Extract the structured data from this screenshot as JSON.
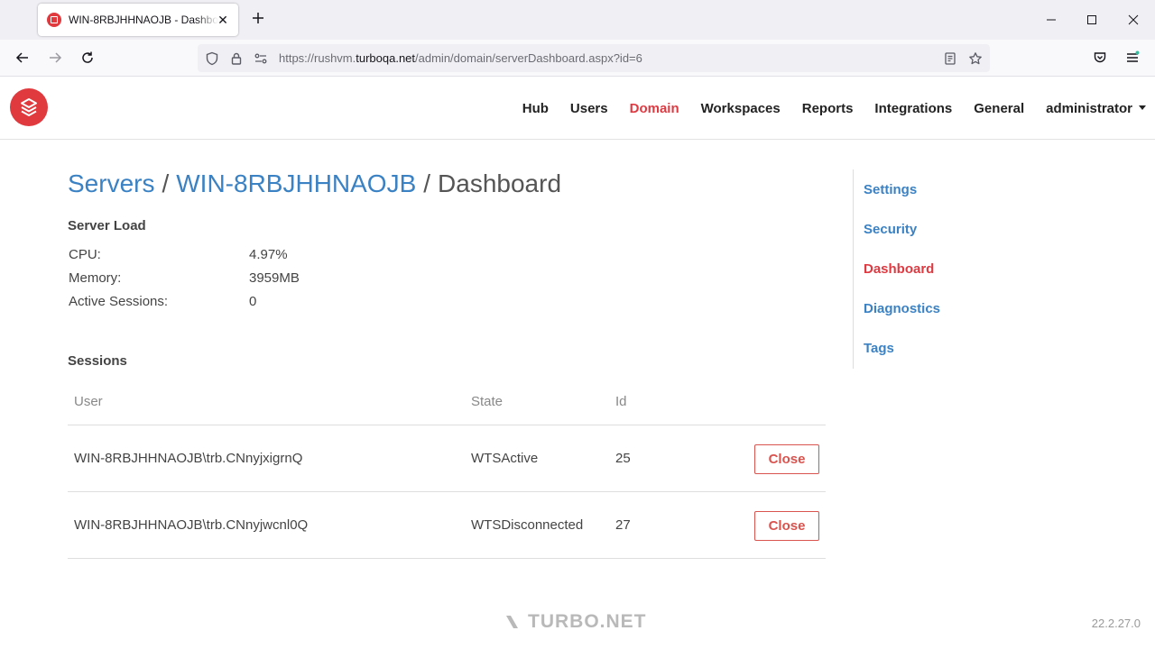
{
  "browser": {
    "tab_title": "WIN-8RBJHHNAOJB - Dashboard",
    "url_prefix": "https://rushvm.",
    "url_host": "turboqa.net",
    "url_path": "/admin/domain/serverDashboard.aspx?id=6"
  },
  "nav": {
    "items": [
      {
        "label": "Hub",
        "active": false
      },
      {
        "label": "Users",
        "active": false
      },
      {
        "label": "Domain",
        "active": true
      },
      {
        "label": "Workspaces",
        "active": false
      },
      {
        "label": "Reports",
        "active": false
      },
      {
        "label": "Integrations",
        "active": false
      },
      {
        "label": "General",
        "active": false
      }
    ],
    "user_label": "administrator"
  },
  "breadcrumb": {
    "servers": "Servers",
    "sep": "/",
    "server": "WIN-8RBJHHNAOJB",
    "current": "Dashboard"
  },
  "server_load": {
    "title": "Server Load",
    "rows": [
      {
        "label": "CPU:",
        "value": "4.97%"
      },
      {
        "label": "Memory:",
        "value": "3959MB"
      },
      {
        "label": "Active Sessions:",
        "value": "0"
      }
    ]
  },
  "sessions": {
    "title": "Sessions",
    "headers": {
      "user": "User",
      "state": "State",
      "id": "Id"
    },
    "rows": [
      {
        "user": "WIN-8RBJHHNAOJB\\trb.CNnyjxigrnQ",
        "state": "WTSActive",
        "id": "25",
        "action": "Close"
      },
      {
        "user": "WIN-8RBJHHNAOJB\\trb.CNnyjwcnl0Q",
        "state": "WTSDisconnected",
        "id": "27",
        "action": "Close"
      }
    ]
  },
  "sidenav": {
    "items": [
      {
        "label": "Settings",
        "active": false
      },
      {
        "label": "Security",
        "active": false
      },
      {
        "label": "Dashboard",
        "active": true
      },
      {
        "label": "Diagnostics",
        "active": false
      },
      {
        "label": "Tags",
        "active": false
      }
    ]
  },
  "footer": {
    "brand": "TURBO.NET",
    "version": "22.2.27.0"
  },
  "icons": {
    "tab_favicon": "turbo-favicon-icon",
    "new_tab": "plus-icon",
    "back": "arrow-left-icon",
    "forward": "arrow-right-icon",
    "reload": "reload-icon",
    "shield": "shield-icon",
    "lock": "lock-icon",
    "permissions": "permissions-icon",
    "reader": "reader-view-icon",
    "bookmark": "star-icon",
    "pocket": "pocket-icon",
    "menu": "hamburger-menu-icon"
  },
  "colors": {
    "brand_red": "#e0393e",
    "link_blue": "#3b82c4",
    "active_red": "#dd3a42",
    "button_red": "#d9534f"
  }
}
